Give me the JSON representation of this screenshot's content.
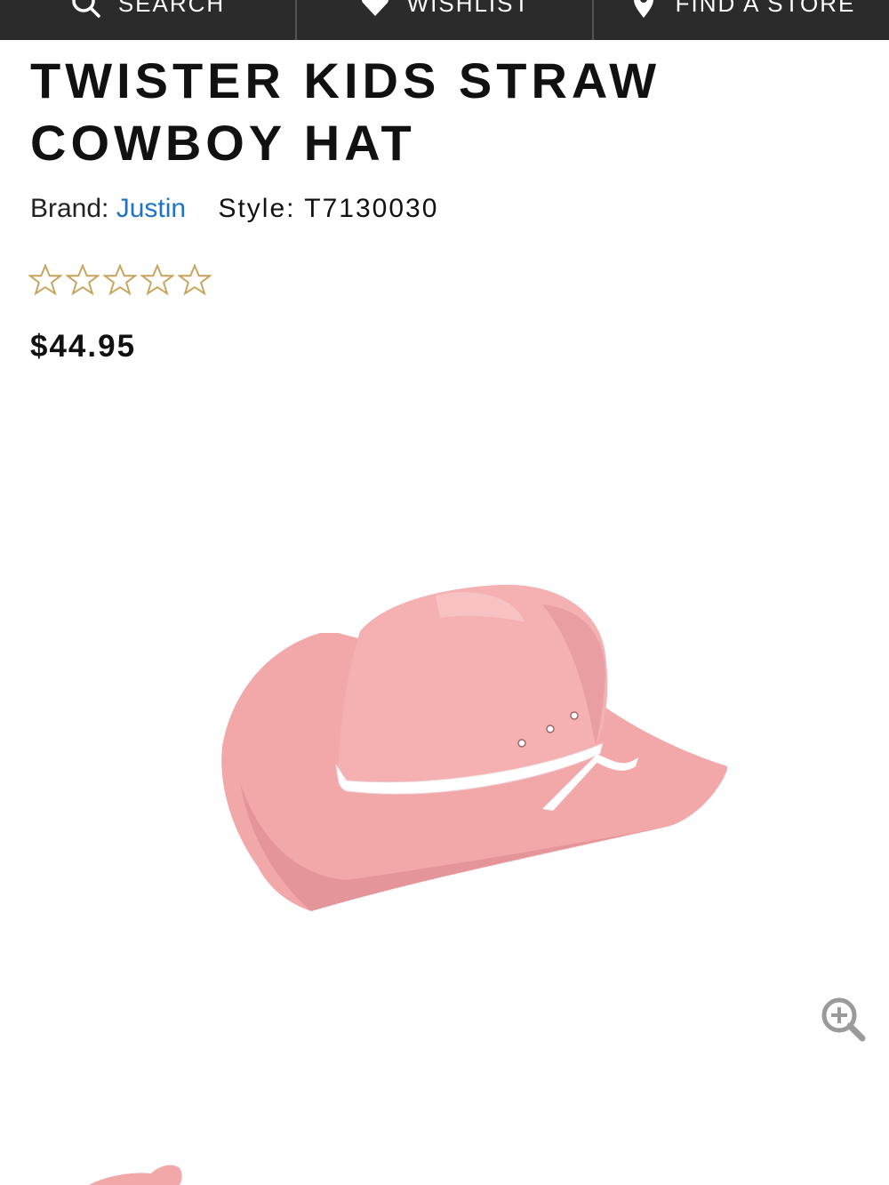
{
  "nav": {
    "items": [
      {
        "label": "SEARCH",
        "icon": "search-icon"
      },
      {
        "label": "WISHLIST",
        "icon": "heart-icon"
      },
      {
        "label": "FIND A STORE",
        "icon": "map-pin-icon"
      }
    ]
  },
  "product": {
    "title_line1": "TWISTER KIDS STRAW",
    "title_line2": "COWBOY HAT",
    "brand_label": "Brand:",
    "brand_value": "Justin",
    "style_text": "Style: T7130030",
    "rating": {
      "value": 0,
      "max": 5
    },
    "price": "$44.95"
  },
  "colors": {
    "nav_bg": "#2b2b2b",
    "link": "#1e73c6",
    "star_outline": "#c9a15a",
    "hat": "#f2a7a9"
  },
  "icons": {
    "zoom": "zoom-in-icon"
  }
}
